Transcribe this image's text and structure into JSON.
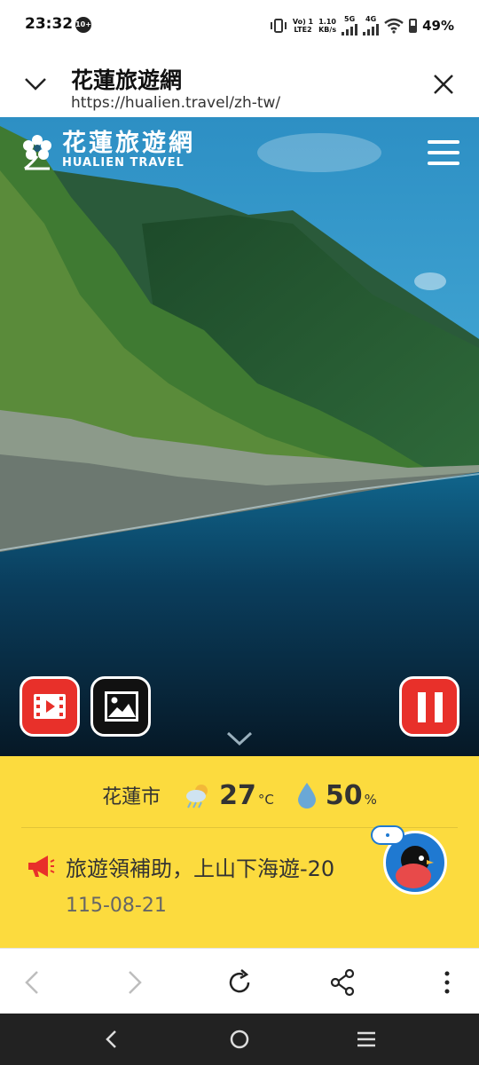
{
  "status_bar": {
    "time": "23:32",
    "notification_badge": "10+",
    "volte": "Vo) 1",
    "lte": "LTE2",
    "speed_value": "1.10",
    "speed_unit": "KB/s",
    "net1": "5G",
    "net2": "4G",
    "battery": "49%"
  },
  "browser": {
    "page_title": "花蓮旅遊網",
    "url": "https://hualien.travel/zh-tw/"
  },
  "site": {
    "logo_cn": "花蓮旅遊網",
    "logo_en": "HUALIEN TRAVEL"
  },
  "hero": {
    "buttons": [
      "video-icon",
      "image-icon",
      "pause-icon"
    ],
    "accent_red": "#e8302a"
  },
  "weather": {
    "city": "花蓮市",
    "temperature": "27",
    "temperature_unit": "°C",
    "humidity": "50",
    "humidity_unit": "%"
  },
  "news": {
    "headline": "旅遊領補助，上山下海遊-20",
    "date": "115-08-21"
  },
  "colors": {
    "panel_yellow": "#fcdb3e",
    "accent_red": "#e8302a",
    "bot_blue": "#1f79d1"
  }
}
